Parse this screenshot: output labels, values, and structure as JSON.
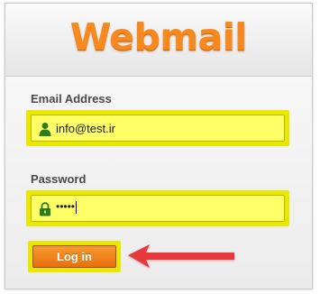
{
  "logo": {
    "text": "Webmail"
  },
  "form": {
    "email_label": "Email Address",
    "email_value": "info@test.ir",
    "password_label": "Password",
    "password_dots": "•••••",
    "login_label": "Log in"
  },
  "colors": {
    "brand_orange": "#f7891f",
    "highlight_yellow": "#e8e800",
    "field_fill": "#ffff66",
    "arrow_red": "#e8383a"
  },
  "icons": {
    "email_field_icon": "user-icon",
    "password_field_icon": "lock-icon",
    "annotation": "arrow-left-icon"
  }
}
